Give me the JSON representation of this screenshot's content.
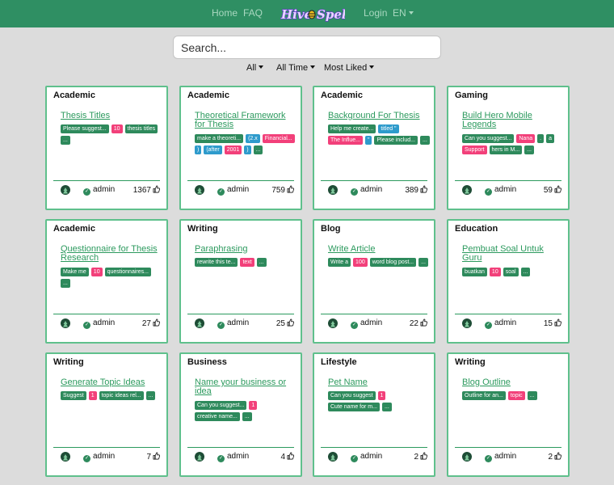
{
  "nav": {
    "home": "Home",
    "faq": "FAQ",
    "logo_text": "HiveSpell",
    "login": "Login",
    "language": "EN"
  },
  "search": {
    "placeholder": "Search..."
  },
  "filters": {
    "category": "All",
    "time": "All Time",
    "sort": "Most Liked"
  },
  "colors": {
    "brand": "#2f8f63",
    "accent_pink": "#f2407a",
    "tag_green": "#2e8a5c",
    "tag_blue": "#2e9bcc"
  },
  "cards": [
    {
      "category": "Academic",
      "title": "Thesis Titles",
      "tags": [
        {
          "text": "Please suggest...",
          "color": "green"
        },
        {
          "text": "10",
          "color": "pink"
        },
        {
          "text": "thesis titles",
          "color": "green"
        },
        {
          "text": "...",
          "color": "green"
        }
      ],
      "author": "admin",
      "likes": "1367"
    },
    {
      "category": "Academic",
      "title": "Theoretical Framework for Thesis",
      "tags": [
        {
          "text": "make a theoreti...",
          "color": "green"
        },
        {
          "text": "(2.x",
          "color": "blue"
        },
        {
          "text": "Financial...",
          "color": "pink"
        },
        {
          "text": ")",
          "color": "blue"
        },
        {
          "text": "(after",
          "color": "blue"
        },
        {
          "text": "2001",
          "color": "pink"
        },
        {
          "text": ")",
          "color": "blue"
        },
        {
          "text": "...",
          "color": "green"
        }
      ],
      "author": "admin",
      "likes": "759"
    },
    {
      "category": "Academic",
      "title": "Background For Thesis",
      "tags": [
        {
          "text": "Help me create...",
          "color": "green"
        },
        {
          "text": "titled \"",
          "color": "blue"
        },
        {
          "text": "The Influe...",
          "color": "pink"
        },
        {
          "text": "\"",
          "color": "blue"
        },
        {
          "text": "Please includ...",
          "color": "green"
        },
        {
          "text": "...",
          "color": "green"
        }
      ],
      "author": "admin",
      "likes": "389"
    },
    {
      "category": "Gaming",
      "title": "Build Hero Mobile Legends",
      "tags": [
        {
          "text": "Can you suggest...",
          "color": "green"
        },
        {
          "text": "Nana",
          "color": "pink"
        },
        {
          "text": ".",
          "color": "green"
        },
        {
          "text": "a",
          "color": "green"
        },
        {
          "text": "Support",
          "color": "pink"
        },
        {
          "text": "hers in M...",
          "color": "green"
        },
        {
          "text": "...",
          "color": "green"
        }
      ],
      "author": "admin",
      "likes": "59"
    },
    {
      "category": "Academic",
      "title": "Questionnaire for Thesis Research",
      "tags": [
        {
          "text": "Make me",
          "color": "green"
        },
        {
          "text": "10",
          "color": "pink"
        },
        {
          "text": "questionnaires...",
          "color": "green"
        },
        {
          "text": "...",
          "color": "green"
        }
      ],
      "author": "admin",
      "likes": "27"
    },
    {
      "category": "Writing",
      "title": "Paraphrasing",
      "tags": [
        {
          "text": "rewrite this te...",
          "color": "green"
        },
        {
          "text": "text",
          "color": "pink"
        },
        {
          "text": "...",
          "color": "green"
        }
      ],
      "author": "admin",
      "likes": "25"
    },
    {
      "category": "Blog",
      "title": "Write Article",
      "tags": [
        {
          "text": "Write a",
          "color": "green"
        },
        {
          "text": "100",
          "color": "pink"
        },
        {
          "text": "word blog post...",
          "color": "green"
        },
        {
          "text": "...",
          "color": "green"
        }
      ],
      "author": "admin",
      "likes": "22"
    },
    {
      "category": "Education",
      "title": "Pembuat Soal Untuk Guru",
      "tags": [
        {
          "text": "buatkan",
          "color": "green"
        },
        {
          "text": "10",
          "color": "pink"
        },
        {
          "text": "soal",
          "color": "green"
        },
        {
          "text": "...",
          "color": "green"
        }
      ],
      "author": "admin",
      "likes": "15"
    },
    {
      "category": "Writing",
      "title": "Generate Topic Ideas",
      "tags": [
        {
          "text": "Suggest",
          "color": "green"
        },
        {
          "text": "1",
          "color": "pink"
        },
        {
          "text": "topic ideas rel...",
          "color": "green"
        },
        {
          "text": "...",
          "color": "green"
        }
      ],
      "author": "admin",
      "likes": "7"
    },
    {
      "category": "Business",
      "title": "Name your business or idea",
      "tags": [
        {
          "text": "Can you suggest...",
          "color": "green"
        },
        {
          "text": "1",
          "color": "pink"
        },
        {
          "text": "creative name...",
          "color": "green"
        },
        {
          "text": "...",
          "color": "green"
        }
      ],
      "author": "admin",
      "likes": "4"
    },
    {
      "category": "Lifestyle",
      "title": "Pet Name",
      "tags": [
        {
          "text": "Can you suggest",
          "color": "green"
        },
        {
          "text": "1",
          "color": "pink"
        },
        {
          "text": "Cute name for m...",
          "color": "green"
        },
        {
          "text": "...",
          "color": "green"
        }
      ],
      "author": "admin",
      "likes": "2"
    },
    {
      "category": "Writing",
      "title": "Blog Outline",
      "tags": [
        {
          "text": "Outline for an...",
          "color": "green"
        },
        {
          "text": "topic",
          "color": "pink"
        },
        {
          "text": "...",
          "color": "green"
        }
      ],
      "author": "admin",
      "likes": "2"
    }
  ]
}
